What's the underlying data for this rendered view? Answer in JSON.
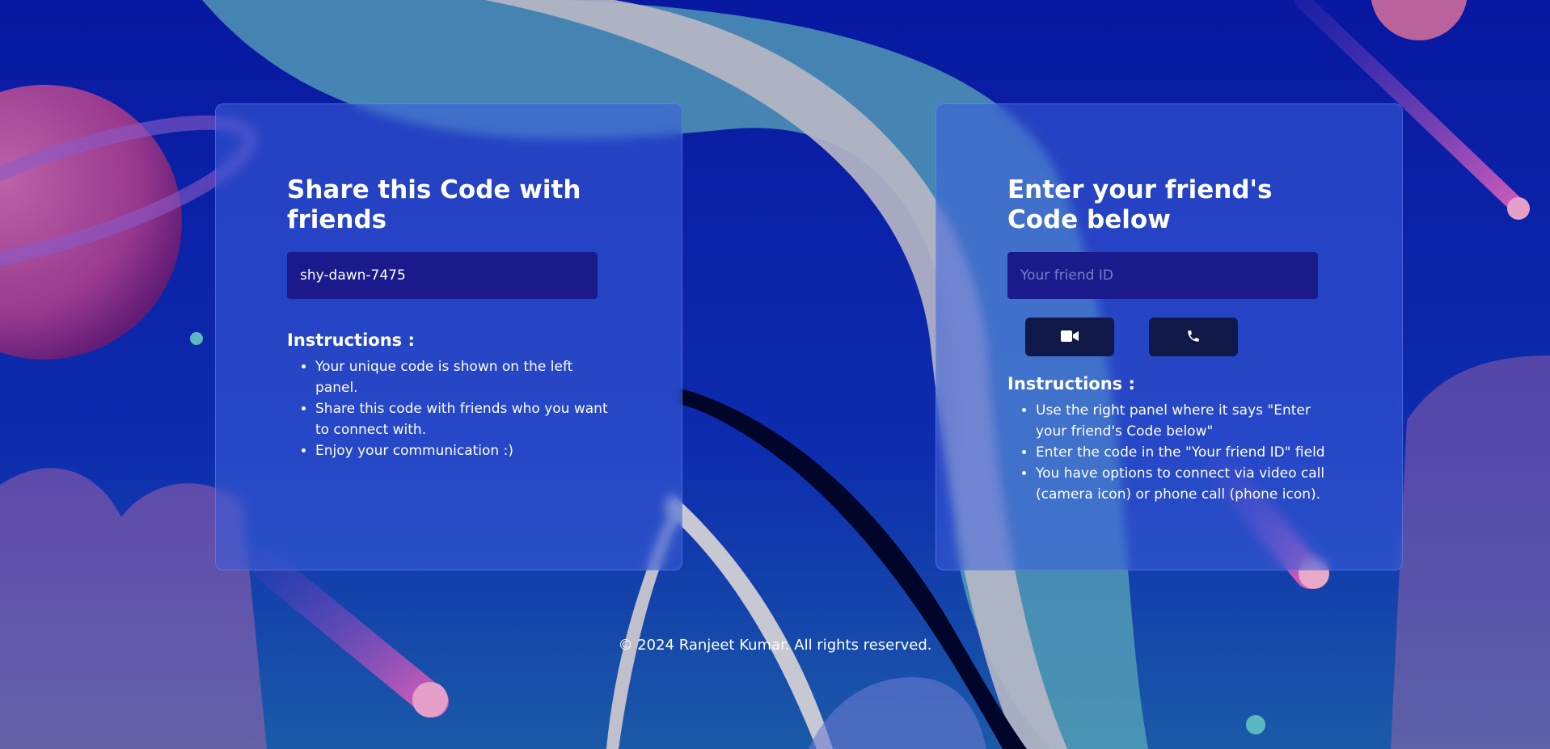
{
  "share_panel": {
    "heading": "Share this Code with friends",
    "code": "shy-dawn-7475",
    "instructions_title": "Instructions :",
    "instructions": [
      "Your unique code is shown on the left panel.",
      "Share this code with friends who you want to connect with.",
      "Enjoy your communication :)"
    ]
  },
  "join_panel": {
    "heading": "Enter your friend's Code below",
    "input_placeholder": "Your friend ID",
    "input_value": "",
    "video_call_icon": "video-camera-icon",
    "phone_call_icon": "phone-icon",
    "instructions_title": "Instructions :",
    "instructions": [
      "Use the right panel where it says \"Enter your friend's Code below\"",
      "Enter the code in the \"Your friend ID\" field",
      "You have options to connect via video call (camera icon) or phone call (phone icon)."
    ]
  },
  "footer": {
    "copyright": "© 2024 Ranjeet Kumar. All rights reserved."
  },
  "colors": {
    "background": "#0a1fa8",
    "panel": "#3c5fdc",
    "input_bg": "#1a1a8c",
    "button_bg": "#101848",
    "planet_pink": "#c0407f",
    "streak_teal": "#5fb8b0"
  }
}
